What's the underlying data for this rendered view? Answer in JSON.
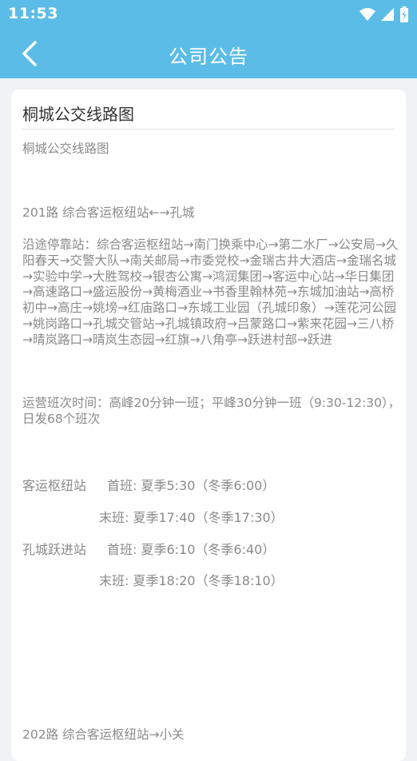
{
  "status": {
    "time": "11:53"
  },
  "header": {
    "title": "公司公告"
  },
  "article": {
    "title": "桐城公交线路图",
    "subtitle": "桐城公交线路图",
    "route201_heading": "201路 综合客运枢纽站←→孔城",
    "route201_stops": "沿途停靠站：综合客运枢纽站→南门换乘中心→第二水厂→公安局→久阳春天→交警大队→南关邮局→市委党校→金瑞古井大酒店→金瑞名城→实验中学→大胜驾校→银杏公寓→鸿润集团→客运中心站→华日集团→高速路口→盛运股份→黄梅酒业→书香里翰林苑→东城加油站→高桥初中→高庄→姚塝→红庙路口→东城工业园（孔城印象）→莲花河公园→姚岗路口→孔城交管站→孔城镇政府→吕蒙路口→紫来花园→三八桥→晴岚路口→晴岚生态园→红旗→八角亭→跃进村部→跃进",
    "route201_frequency": "运营班次时间：高峰20分钟一班；平峰30分钟一班（9:30-12:30），日发68个班次",
    "schedule": [
      {
        "station": "客运枢纽站",
        "first": "首班: 夏季5:30（冬季6:00）",
        "last": "末班: 夏季17:40（冬季17:30）"
      },
      {
        "station": "孔城跃进站",
        "first": "首班: 夏季6:10（冬季6:40）",
        "last": "末班: 夏季18:20（冬季18:10）"
      }
    ],
    "route202_heading": "202路 综合客运枢纽站→小关"
  }
}
